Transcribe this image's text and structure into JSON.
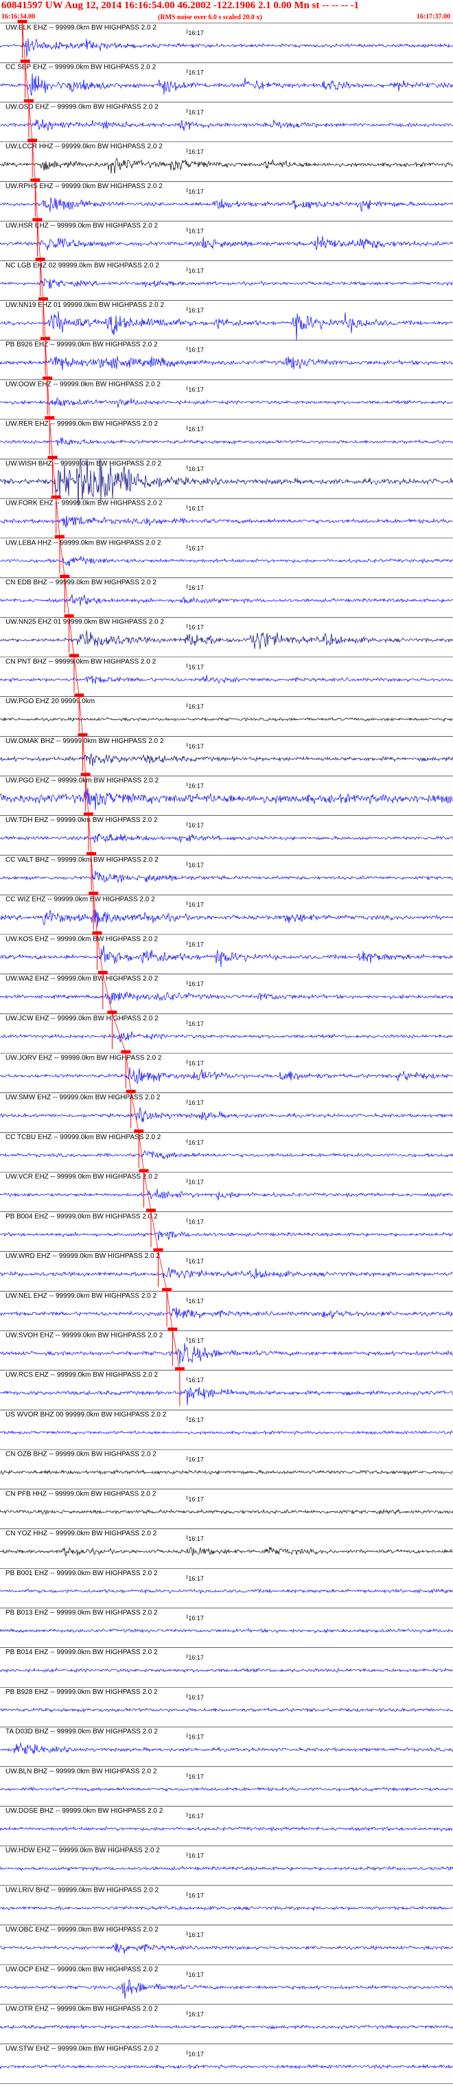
{
  "header": {
    "title": "60841597 UW Aug 12, 2014 16:16:54.00   46.2002 -122.1906  2.1 0.00 Mn st -- -- --  -1",
    "start_time": "16:16:34.00",
    "end_time": "16:17:37.00",
    "rms_note": "(RMS noise over 6.0 s scaled 20.0 x)"
  },
  "colors": {
    "trace_blue": "#0000ff",
    "trace_navy": "#000080",
    "trace_black": "#000000",
    "pick_red": "#ff0000",
    "text_red": "#ff0000"
  },
  "chart_data": {
    "type": "seismogram",
    "time_range": [
      "16:16:34.00",
      "16:17:37.00"
    ],
    "tick_label": "16:17",
    "traces": [
      {
        "label": "UW.ELK EHZ -- 99999.0km BW  HIGHPASS  2.0  2",
        "color": "blue",
        "pick_time": 3.1,
        "energy": 0.5,
        "events": [
          [
            3.5,
            1.3
          ],
          [
            12,
            0.5
          ]
        ]
      },
      {
        "label": "CC SEP EHZ -- 99999.0km BW  HIGHPASS  2.0  2",
        "color": "blue",
        "pick_time": 3.5,
        "energy": 0.5,
        "events": [
          [
            4,
            1.3
          ],
          [
            10,
            0.8
          ],
          [
            22,
            1.0
          ],
          [
            34,
            0.8
          ],
          [
            45,
            0.6
          ],
          [
            55,
            0.5
          ]
        ]
      },
      {
        "label": "UW.OSD EHZ -- 99999.0km BW  HIGHPASS  2.0  2",
        "color": "blue",
        "pick_time": 4.0,
        "energy": 0.5,
        "events": [
          [
            5,
            0.7
          ],
          [
            13,
            0.6
          ],
          [
            25,
            0.5
          ],
          [
            38,
            0.5
          ]
        ]
      },
      {
        "label": "UW.LCCR HHZ -- 99999.0km BW  HIGHPASS  2.0  2",
        "color": "black",
        "pick_time": 4.5,
        "energy": 0.6,
        "events": [
          [
            6,
            0.5
          ],
          [
            15,
            1.0
          ],
          [
            24,
            0.7
          ],
          [
            37,
            0.4
          ]
        ]
      },
      {
        "label": "UW.RPHS EHZ -- 99999.0km BW  HIGHPASS  2.0  2",
        "color": "blue",
        "pick_time": 4.9,
        "energy": 0.5,
        "events": [
          [
            6,
            1.4
          ],
          [
            30,
            0.6
          ],
          [
            41,
            0.7
          ],
          [
            50,
            0.6
          ]
        ]
      },
      {
        "label": "UW.HSR EHZ -- 99999.0km BW  HIGHPASS  2.0  2",
        "color": "blue",
        "pick_time": 5.2,
        "energy": 0.6,
        "events": [
          [
            6,
            1.1
          ],
          [
            28,
            0.8
          ],
          [
            44,
            1.0
          ],
          [
            50,
            0.6
          ]
        ]
      },
      {
        "label": "NC LGB EHZ 02 99999.0km BW  HIGHPASS  2.0  2",
        "color": "blue",
        "pick_time": 5.6,
        "energy": 0.5,
        "events": [
          [
            6,
            0.6
          ],
          [
            20,
            0.3
          ]
        ]
      },
      {
        "label": "UW.NN19 EHZ 01 99999.0km BW  HIGHPASS  2.0  2",
        "color": "blue",
        "pick_time": 6.0,
        "energy": 0.5,
        "events": [
          [
            7,
            1.6
          ],
          [
            15,
            1.6
          ],
          [
            21,
            0.6
          ],
          [
            30,
            0.6
          ],
          [
            41,
            1.5
          ],
          [
            48,
            0.8
          ]
        ]
      },
      {
        "label": "PB B926 EHZ -- 99999.0km BW  HIGHPASS  2.0  2",
        "color": "blue",
        "pick_time": 6.3,
        "energy": 0.6,
        "events": [
          [
            7,
            1.2
          ],
          [
            14,
            1.0
          ],
          [
            21,
            0.6
          ],
          [
            40,
            0.9
          ]
        ]
      },
      {
        "label": "UW.OOW EHZ -- 99999.0km BW  HIGHPASS  2.0  2",
        "color": "blue",
        "pick_time": 6.6,
        "energy": 0.5,
        "events": [
          [
            7,
            0.6
          ],
          [
            16,
            0.4
          ]
        ]
      },
      {
        "label": "UW.RER EHZ -- 99999.0km BW  HIGHPASS  2.0  2",
        "color": "blue",
        "pick_time": 6.9,
        "energy": 0.5,
        "events": [
          [
            8,
            0.5
          ]
        ]
      },
      {
        "label": "UW.WISH BHZ -- 99999.0km BW  HIGHPASS  2.0  2",
        "color": "navy",
        "pick_time": 7.3,
        "energy": 0.8,
        "events": [
          [
            8,
            3.0
          ],
          [
            11,
            2.5
          ],
          [
            14,
            1.8
          ],
          [
            17,
            1.0
          ]
        ]
      },
      {
        "label": "UW.FORK EHZ -- 99999.0km BW  HIGHPASS  2.0  2",
        "color": "blue",
        "pick_time": 7.8,
        "energy": 0.6,
        "events": [
          [
            9,
            0.9
          ],
          [
            20,
            0.4
          ]
        ]
      },
      {
        "label": "UW.LEBA HHZ -- 99999.0km BW  HIGHPASS  2.0  2",
        "color": "blue",
        "pick_time": 8.3,
        "energy": 0.5,
        "events": [
          [
            9,
            0.6
          ]
        ]
      },
      {
        "label": "CN EDB BHZ -- 99999.0km BW  HIGHPASS  2.0  2",
        "color": "blue",
        "pick_time": 9.0,
        "energy": 0.5,
        "events": [
          [
            10,
            0.7
          ],
          [
            25,
            0.4
          ]
        ]
      },
      {
        "label": "UW.NN25 EHZ 01 99999.0km BW  HIGHPASS  2.0  2",
        "color": "navy",
        "pick_time": 9.6,
        "energy": 0.5,
        "events": [
          [
            11,
            1.2
          ],
          [
            14,
            0.6
          ],
          [
            26,
            1.0
          ],
          [
            35,
            1.8
          ],
          [
            45,
            0.7
          ]
        ]
      },
      {
        "label": "CN PNT BHZ -- 99999.0km BW  HIGHPASS  2.0  2",
        "color": "blue",
        "pick_time": 10.3,
        "energy": 0.5,
        "events": [
          [
            12,
            0.5
          ],
          [
            28,
            0.4
          ]
        ]
      },
      {
        "label": "UW.PGO EHZ 20 99999.0km",
        "color": "black",
        "pick_time": 11.0,
        "energy": 0.45,
        "events": []
      },
      {
        "label": "UW.OMAK BHZ -- 99999.0km BW  HIGHPASS  2.0  2",
        "color": "navy",
        "pick_time": 11.5,
        "energy": 0.6,
        "events": [
          [
            12,
            1.0
          ],
          [
            20,
            0.4
          ]
        ]
      },
      {
        "label": "UW.PGO EHZ -- 99999.0km BW  HIGHPASS  2.0  2",
        "color": "blue",
        "pick_time": 11.9,
        "energy": 1.3,
        "events": [
          [
            12,
            1.0
          ]
        ]
      },
      {
        "label": "UW.TDH EHZ -- 99999.0km BW  HIGHPASS  2.0  2",
        "color": "blue",
        "pick_time": 12.3,
        "energy": 0.5,
        "events": [
          [
            13,
            0.9
          ],
          [
            25,
            0.4
          ]
        ]
      },
      {
        "label": "CC VALT BHZ -- 99999.0km BW  HIGHPASS  2.0  2",
        "color": "blue",
        "pick_time": 12.7,
        "energy": 0.5,
        "events": [
          [
            13,
            0.8
          ],
          [
            20,
            0.5
          ]
        ]
      },
      {
        "label": "CC WIZ EHZ -- 99999.0km BW  HIGHPASS  2.0  2",
        "color": "blue",
        "pick_time": 13.0,
        "energy": 0.6,
        "events": [
          [
            6,
            1.0
          ],
          [
            13,
            1.0
          ],
          [
            20,
            0.6
          ],
          [
            40,
            0.6
          ]
        ]
      },
      {
        "label": "UW.KOS EHZ -- 99999.0km BW  HIGHPASS  2.0  2",
        "color": "blue",
        "pick_time": 13.5,
        "energy": 0.6,
        "events": [
          [
            14,
            1.1
          ],
          [
            20,
            1.0
          ],
          [
            30,
            0.8
          ],
          [
            50,
            0.7
          ]
        ]
      },
      {
        "label": "UW.WA2 EHZ -- 99999.0km BW  HIGHPASS  2.0  2",
        "color": "blue",
        "pick_time": 14.3,
        "energy": 0.5,
        "events": [
          [
            15,
            1.0
          ],
          [
            22,
            0.6
          ],
          [
            36,
            0.5
          ]
        ]
      },
      {
        "label": "UW.JCW EHZ -- 99999.0km BW  HIGHPASS  2.0  2",
        "color": "blue",
        "pick_time": 15.6,
        "energy": 0.5,
        "events": [
          [
            16,
            0.6
          ]
        ]
      },
      {
        "label": "UW.JORV EHZ -- 99999.0km BW  HIGHPASS  2.0  2",
        "color": "blue",
        "pick_time": 17.5,
        "energy": 0.5,
        "events": [
          [
            18,
            1.4
          ],
          [
            27,
            0.7
          ],
          [
            39,
            0.8
          ],
          [
            55,
            0.7
          ]
        ]
      },
      {
        "label": "UW.SMW EHZ -- 99999.0km BW  HIGHPASS  2.0  2",
        "color": "blue",
        "pick_time": 18.2,
        "energy": 0.5,
        "events": [
          [
            19,
            0.8
          ],
          [
            28,
            0.4
          ]
        ]
      },
      {
        "label": "CC TCBU EHZ -- 99999.0km BW  HIGHPASS  2.0  2",
        "color": "blue",
        "pick_time": 19.3,
        "energy": 0.5,
        "events": [
          [
            20,
            0.6
          ]
        ]
      },
      {
        "label": "UW.VCR EHZ -- 99999.0km BW  HIGHPASS  2.0  2",
        "color": "blue",
        "pick_time": 20.0,
        "energy": 0.5,
        "events": [
          [
            21,
            0.7
          ],
          [
            30,
            0.4
          ]
        ]
      },
      {
        "label": "PB B004 EHZ -- 99999.0km BW  HIGHPASS  2.0  2",
        "color": "blue",
        "pick_time": 21.0,
        "energy": 0.5,
        "events": [
          [
            22,
            0.5
          ]
        ]
      },
      {
        "label": "UW.WRD EHZ -- 99999.0km BW  HIGHPASS  2.0  2",
        "color": "blue",
        "pick_time": 22.0,
        "energy": 0.6,
        "events": [
          [
            23,
            1.0
          ],
          [
            35,
            0.5
          ]
        ]
      },
      {
        "label": "UW.NEL EHZ -- 99999.0km BW  HIGHPASS  2.0  2",
        "color": "blue",
        "pick_time": 23.2,
        "energy": 0.6,
        "events": [
          [
            24,
            1.0
          ],
          [
            45,
            0.5
          ]
        ]
      },
      {
        "label": "UW.SVOH EHZ -- 99999.0km BW  HIGHPASS  2.0  2",
        "color": "blue",
        "pick_time": 24.0,
        "energy": 0.6,
        "events": [
          [
            25,
            1.6
          ]
        ]
      },
      {
        "label": "UW.RCS EHZ -- 99999.0km BW  HIGHPASS  2.0  2",
        "color": "blue",
        "pick_time": 25.0,
        "energy": 0.6,
        "events": [
          [
            26,
            1.2
          ]
        ]
      },
      {
        "label": "US WVOR BHZ 00 99999.0km BW  HIGHPASS  2.0  2",
        "color": "blue",
        "pick_time": null,
        "energy": 0.45,
        "events": []
      },
      {
        "label": "CN OZB BHZ -- 99999.0km BW  HIGHPASS  2.0  2",
        "color": "black",
        "pick_time": null,
        "energy": 0.55,
        "events": []
      },
      {
        "label": "CN PFB HHZ -- 99999.0km BW  HIGHPASS  2.0  2",
        "color": "black",
        "pick_time": null,
        "energy": 0.55,
        "events": []
      },
      {
        "label": "CN YOZ HHZ -- 99999.0km BW  HIGHPASS  2.0  2",
        "color": "black",
        "pick_time": null,
        "energy": 0.5,
        "events": [
          [
            9,
            0.6
          ],
          [
            26,
            0.5
          ],
          [
            37,
            0.5
          ]
        ]
      },
      {
        "label": "PB B001 EHZ -- 99999.0km BW  HIGHPASS  2.0  2",
        "color": "blue",
        "pick_time": null,
        "energy": 0.5,
        "events": []
      },
      {
        "label": "PB B013 EHZ -- 99999.0km BW  HIGHPASS  2.0  2",
        "color": "blue",
        "pick_time": null,
        "energy": 0.5,
        "events": []
      },
      {
        "label": "PB B014 EHZ -- 99999.0km BW  HIGHPASS  2.0  2",
        "color": "blue",
        "pick_time": null,
        "energy": 0.5,
        "events": []
      },
      {
        "label": "PB B928 EHZ -- 99999.0km BW  HIGHPASS  2.0  2",
        "color": "blue",
        "pick_time": null,
        "energy": 0.5,
        "events": []
      },
      {
        "label": "TA D03D BHZ -- 99999.0km BW  HIGHPASS  2.0  2",
        "color": "blue",
        "pick_time": null,
        "energy": 0.5,
        "events": [
          [
            2,
            0.9
          ]
        ]
      },
      {
        "label": "UW.BLN BHZ -- 99999.0km BW  HIGHPASS  2.0  2",
        "color": "blue",
        "pick_time": null,
        "energy": 0.5,
        "events": []
      },
      {
        "label": "UW.DOSE BHZ -- 99999.0km BW  HIGHPASS  2.0  2",
        "color": "blue",
        "pick_time": null,
        "energy": 0.5,
        "events": []
      },
      {
        "label": "UW.HDW EHZ -- 99999.0km BW  HIGHPASS  2.0  2",
        "color": "blue",
        "pick_time": null,
        "energy": 0.5,
        "events": []
      },
      {
        "label": "UW.LRIV BHZ -- 99999.0km BW  HIGHPASS  2.0  2",
        "color": "blue",
        "pick_time": null,
        "energy": 0.5,
        "events": []
      },
      {
        "label": "UW.OBC EHZ -- 99999.0km BW  HIGHPASS  2.0  2",
        "color": "blue",
        "pick_time": null,
        "energy": 0.5,
        "events": [
          [
            16,
            0.8
          ]
        ]
      },
      {
        "label": "UW.OCP EHZ -- 99999.0km BW  HIGHPASS  2.0  2",
        "color": "blue",
        "pick_time": null,
        "energy": 0.5,
        "events": [
          [
            17,
            1.2
          ]
        ]
      },
      {
        "label": "UW.OTR EHZ -- 99999.0km BW  HIGHPASS  2.0  2",
        "color": "blue",
        "pick_time": null,
        "energy": 0.5,
        "events": []
      },
      {
        "label": "UW.STW EHZ -- 99999.0km BW  HIGHPASS  2.0  2",
        "color": "blue",
        "pick_time": null,
        "energy": 0.5,
        "events": []
      }
    ]
  }
}
